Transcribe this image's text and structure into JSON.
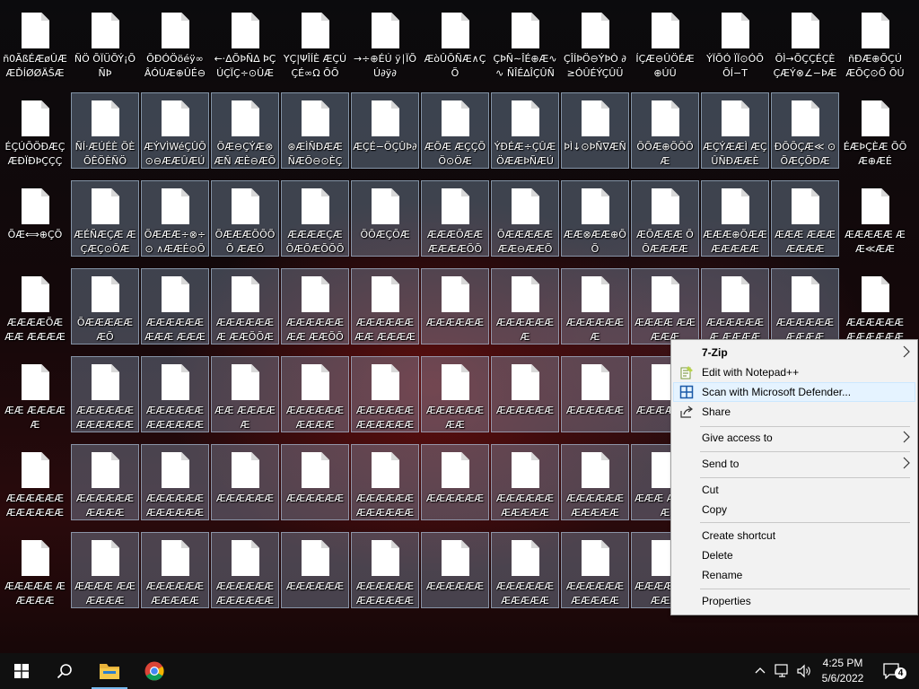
{
  "desktop": {
    "icons": [
      {
        "label": "ñ0ÃßÉÆøÛÆ ÆĎÍØØÄŠÆ ÆØÖÚÈÖþ Ç¾Ø¦Ø",
        "sel": false
      },
      {
        "label": "ÑÖ ÕÏÜÕÝ¡ÕÑÞ",
        "sel": false
      },
      {
        "label": "ÕÐÓÖöéÿ∞ ÂÓÙÆ⊕ÛÉ⊖",
        "sel": false
      },
      {
        "label": "←⋅∆ÕÞÑ∆ ÞÇÚÇÏÇ÷⊙ÛÆ",
        "sel": false
      },
      {
        "label": "ΥÇ|ΨÎÍÈ ÆÇÚÇÉ∞Ω ÕÕ",
        "sel": false
      },
      {
        "label": "→÷⊕ÉÚ ÿ∣ÏÕÚ∂ÿ∂",
        "sel": false
      },
      {
        "label": "ÆòÛÕÑÆ∧ÇÕ",
        "sel": false
      },
      {
        "label": "ÇÞÑ∼ÎÉ⊕Æ∿∿ ÑÎÉ∆ÎÇÛÑ",
        "sel": false
      },
      {
        "label": "ÇÎÍÞÖ⊖ÝÞÒ ∂≥ÓÛÉÝÇÛÜ",
        "sel": false
      },
      {
        "label": "ÍÇÆ⊖ÛÖÉÆ⊕ÚÛ",
        "sel": false
      },
      {
        "label": "ÝÏÕÓ ÏÏ⊙ÓÕÕÍ−Τ",
        "sel": false
      },
      {
        "label": "ÕÌ→ÕÇÇÉÇÈ ÇÆÝ⊗∠−ÞÆ",
        "sel": false
      },
      {
        "label": "ñÐÆ⊕ÕÇÚ ÆÕÇ⊙Õ ÕÚÕ",
        "sel": false
      },
      {
        "label": "ÉÇÚÕÖÐÆÇ ÆÐÏÐÞÇÇÇ",
        "sel": false
      },
      {
        "label": "ÑÍ⋅ÆÚÉÈ ÕÈ ÕÊÖÈÑÖ",
        "sel": true
      },
      {
        "label": "ÆÝVÌWéÇÛÕ ⊙⊖ÆÆÛÆÚ",
        "sel": true
      },
      {
        "label": "ÕÆ⊖ÇÝÆ⊗ÆÑ ÆÈ⊖ÆÕÇÉ⊙",
        "sel": true
      },
      {
        "label": "⊛ÆÌÑÐÆÆ ÑÆÕ⊖⊙ÈÇ",
        "sel": true
      },
      {
        "label": "ÆÇÉ−ÖÇÛÞ∂",
        "sel": true
      },
      {
        "label": "ÆÕÆ ÆÇÇÕÖ⊙ÖÆ",
        "sel": true
      },
      {
        "label": "ÝÐÉÆ÷ÇÛÆ ÖÆÆÞÑÆÚ",
        "sel": true
      },
      {
        "label": "ÞÌ↓⊙ÞÑ∇ÆÑ",
        "sel": true
      },
      {
        "label": "ÕÕÆ⊕ÕÕÕÆ",
        "sel": true
      },
      {
        "label": "ÆÇÝÆÆÌ ÆÇÛÑÐÆÆÈ",
        "sel": true
      },
      {
        "label": "ÐÕÕÇÆ≪ ⊙ÕÆÇÕÐÆ",
        "sel": true
      },
      {
        "label": "ÉÆÞÇÈÆ ÕÕÆ⊕ÆÉ",
        "sel": false
      },
      {
        "label": "ÕÆ⟺⊕ÇÕ",
        "sel": false
      },
      {
        "label": "ÆÉÑÆÇÆ ÆÇÆÇ⊙ÕÆ",
        "sel": true
      },
      {
        "label": "ÕÆÆÆ÷⊗÷⊙ ∧ÆÆÉ⊙ÕÆ",
        "sel": true
      },
      {
        "label": "ÕÆÆÆÕÕÕÕ ÆÆÕ",
        "sel": true
      },
      {
        "label": "ÆÆÆÆÇÆ ÕÆÕÆÕÕÕ",
        "sel": true
      },
      {
        "label": "ÕÕÆÇÕÆ",
        "sel": true
      },
      {
        "label": "ÆÆÆÕÆÆ ÆÆÆÆÕÕ",
        "sel": true
      },
      {
        "label": "ÕÆÆÆÆÆ ÆÆ⊖ÆÆÕ",
        "sel": true
      },
      {
        "label": "ÆÆ⊗ÆÆ⊕ÕÕ",
        "sel": true
      },
      {
        "label": "ÆÕÆÆÆ ÕÕÆÆÆÆ",
        "sel": true
      },
      {
        "label": "ÆÆÆ⊕ÕÆÆ ÆÆÆÆÆ",
        "sel": true
      },
      {
        "label": "ÆÆÆ ÆÆÆÆÆÆÆ",
        "sel": true
      },
      {
        "label": "ÆÆÆÆÆ ÆÆ≪ÆÆ",
        "sel": false
      },
      {
        "label": "ÆÆÆÆÕÆÆÆ ÆÆÆÆÆÆ",
        "sel": false
      },
      {
        "label": "ÕÆÆÆÆÆÆÕ",
        "sel": true
      },
      {
        "label": "ÆÆÆÆÆÆÆÆÆ ÆÆÆÆÆÆÆ",
        "sel": true
      },
      {
        "label": "ÆÆÆÆÆÆÆ ÆÆÕÕÆÆÆ",
        "sel": true
      },
      {
        "label": "ÆÆÆÆÆÆÆÆ ÆÆÕÕÆÆ",
        "sel": true
      },
      {
        "label": "ÆÆÆÆÆÆÆÆ ÆÆÆÆÕÆ",
        "sel": true
      },
      {
        "label": "ÆÆÆÆÆÆ",
        "sel": true
      },
      {
        "label": "ÆÆÆÆÆÆÆ",
        "sel": true
      },
      {
        "label": "ÆÆÆÆÆÆÆ",
        "sel": true
      },
      {
        "label": "ÆÆÆÆ ÆÆÆÆÆ",
        "sel": true
      },
      {
        "label": "ÆÆÆÆÆÆÆ ÆÆÆÆ",
        "sel": true
      },
      {
        "label": "ÆÆÆÆÆÆ ÆÆÆÆ",
        "sel": true
      },
      {
        "label": "ÆÆÆÆÆÆ ÆÆÆÆÆÆ",
        "sel": false
      },
      {
        "label": "ÆÆ ÆÆÆÆÆ",
        "sel": false
      },
      {
        "label": "ÆÆÆÆÆÆ ÆÆÆÆÆÆ",
        "sel": true
      },
      {
        "label": "ÆÆÆÆÆÆ ÆÆÆÆÆÆ",
        "sel": true
      },
      {
        "label": "ÆÆ ÆÆÆÆÆ",
        "sel": true
      },
      {
        "label": "ÆÆÆÆÆÆ ÆÆÆÆ",
        "sel": true
      },
      {
        "label": "ÆÆÆÆÆÆ ÆÆÆÆÆÆ",
        "sel": true
      },
      {
        "label": "ÆÆÆÆÆÆÆÆ",
        "sel": true
      },
      {
        "label": "ÆÆÆÆÆÆ",
        "sel": true
      },
      {
        "label": "ÆÆÆÆÆÆ",
        "sel": true
      },
      {
        "label": "ÆÆÆÆÆÆ",
        "sel": true
      },
      {
        "label": "ÆÆÆÆÆÆ ÆÆÆÆÆÆ",
        "sel": false
      },
      {
        "label": "ÆÆÆÆÆÆ ÆÆÆÆ",
        "sel": true
      },
      {
        "label": "ÆÆÆÆÆÆ ÆÆÆÆÆÆ",
        "sel": true
      },
      {
        "label": "ÆÆÆÆÆÆ",
        "sel": true
      },
      {
        "label": "ÆÆÆÆÆÆ",
        "sel": true
      },
      {
        "label": "ÆÆÆÆÆÆ ÆÆÆÆÆÆ",
        "sel": true
      },
      {
        "label": "ÆÆÆÆÆÆ",
        "sel": true
      },
      {
        "label": "ÆÆÆÆÆÆ ÆÆÆÆÆ",
        "sel": true
      },
      {
        "label": "ÆÆÆÆÆÆ ÆÆÆÆÆ",
        "sel": true
      },
      {
        "label": "ÆÆÆ ÆÆÆÆ",
        "sel": true
      },
      {
        "label": "ÆÆÆÆÆ ÆÆÆÆÆ",
        "sel": false
      },
      {
        "label": "ÆÆÆÆ ÆÆÆÆÆÆ",
        "sel": true
      },
      {
        "label": "ÆÆÆÆÆÆ ÆÆÆÆÆ",
        "sel": true
      },
      {
        "label": "ÆÆÆÆÆÆ ÆÆÆÆÆÆ",
        "sel": true
      },
      {
        "label": "ÆÆÆÆÆÆ",
        "sel": true
      },
      {
        "label": "ÆÆÆÆÆÆ ÆÆÆÆÆÆ",
        "sel": true
      },
      {
        "label": "ÆÆÆÆÆÆ",
        "sel": true
      },
      {
        "label": "ÆÆÆÆÆÆ ÆÆÆÆÆ",
        "sel": true
      },
      {
        "label": "ÆÆÆÆÆÆ ÆÆÆÆÆ",
        "sel": true
      },
      {
        "label": "ÆÆÆÆÆ ÆÆÆÆ",
        "sel": true
      }
    ]
  },
  "context_menu": {
    "items": [
      {
        "label": "7-Zip",
        "bold": true,
        "submenu": true,
        "icon": "none"
      },
      {
        "label": "Edit with Notepad++",
        "icon": "notepadpp-icon"
      },
      {
        "label": "Scan with Microsoft Defender...",
        "icon": "defender-icon",
        "highlight": true
      },
      {
        "label": "Share",
        "icon": "share-icon"
      },
      {
        "label": "Give access to",
        "submenu": true
      },
      {
        "label": "Send to",
        "submenu": true
      },
      {
        "label": "Cut"
      },
      {
        "label": "Copy"
      },
      {
        "label": "Create shortcut"
      },
      {
        "label": "Delete"
      },
      {
        "label": "Rename"
      },
      {
        "label": "Properties"
      }
    ]
  },
  "taskbar": {
    "time": "4:25 PM",
    "date": "5/6/2022",
    "notification_count": "4",
    "icons": [
      "windows-start-icon",
      "search-icon",
      "file-explorer-icon",
      "chrome-icon"
    ],
    "tray": [
      "chevron-up-icon",
      "network-icon",
      "volume-icon"
    ]
  }
}
